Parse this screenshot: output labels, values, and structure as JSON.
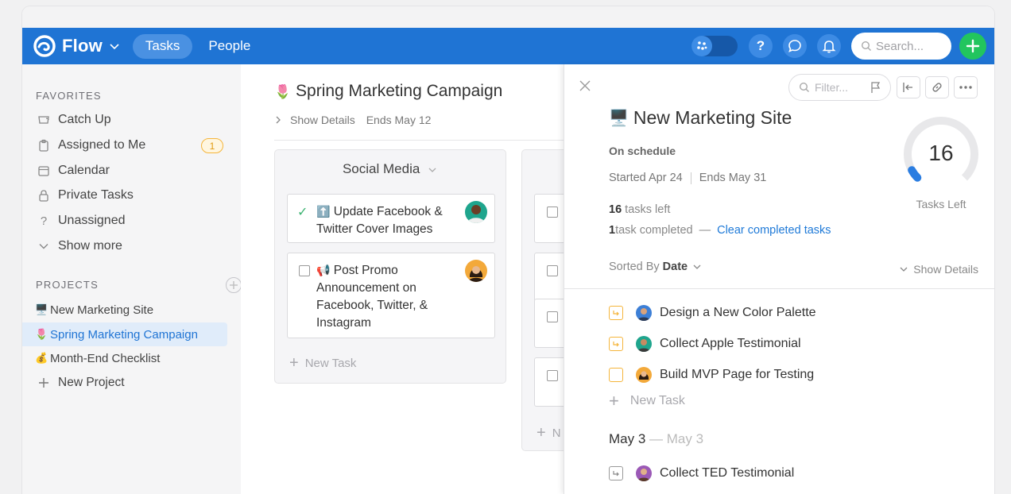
{
  "header": {
    "brand": "Flow",
    "tabs": [
      {
        "label": "Tasks",
        "active": true
      },
      {
        "label": "People",
        "active": false
      }
    ],
    "search_placeholder": "Search...",
    "help_label": "?"
  },
  "sidebar": {
    "favorites_heading": "FAVORITES",
    "favorites": [
      {
        "label": "Catch Up",
        "icon": "inbox-icon"
      },
      {
        "label": "Assigned to Me",
        "icon": "clipboard-icon",
        "badge": "1"
      },
      {
        "label": "Calendar",
        "icon": "calendar-icon"
      },
      {
        "label": "Private Tasks",
        "icon": "lock-icon"
      },
      {
        "label": "Unassigned",
        "icon": "question-icon"
      },
      {
        "label": "Show more",
        "icon": "chevron-down-icon"
      }
    ],
    "projects_heading": "PROJECTS",
    "projects": [
      {
        "label": "New Marketing Site",
        "emoji": "🖥️"
      },
      {
        "label": "Spring Marketing Campaign",
        "emoji": "🌷",
        "active": true
      },
      {
        "label": "Month-End Checklist",
        "emoji": "💰"
      }
    ],
    "new_project": "New Project"
  },
  "main": {
    "project_emoji": "🌷",
    "project_title": "Spring Marketing Campaign",
    "show_details": "Show Details",
    "ends": "Ends May 12",
    "columns": [
      {
        "title": "Social Media",
        "cards": [
          {
            "emoji": "⬆️",
            "title": "Update Facebook & Twitter Cover Images",
            "done": true
          },
          {
            "emoji": "📢",
            "title": "Post Promo Announcement on Facebook, Twitter, & Instagram",
            "done": false
          }
        ],
        "new_task": "New Task"
      }
    ],
    "column2_new_task": "N"
  },
  "panel": {
    "filter_placeholder": "Filter...",
    "emoji": "🖥️",
    "title": "New Marketing Site",
    "status": "On schedule",
    "started": "Started Apr 24",
    "ends": "Ends May 31",
    "tasks_left_count": "16",
    "tasks_left_suffix": " tasks left",
    "completed_count": "1",
    "completed_suffix": " task completed",
    "completed_dash": "—",
    "clear_link": "Clear completed tasks",
    "gauge_value": "16",
    "gauge_label": "Tasks Left",
    "gauge_fraction": 0.06,
    "sorted_by": "Sorted By",
    "sort_key": "Date",
    "show_details": "Show Details",
    "tasks": [
      {
        "title": "Design a New Color Palette",
        "box": "subtask"
      },
      {
        "title": "Collect Apple Testimonial",
        "box": "subtask"
      },
      {
        "title": "Build MVP Page for Testing",
        "box": "plain"
      }
    ],
    "new_task": "New Task",
    "date_group": "May 3",
    "date_group_range": "— May 3",
    "group_tasks": [
      {
        "title": "Collect TED Testimonial",
        "box": "subtask-gray"
      }
    ]
  },
  "colors": {
    "header_blue": "#1f74d4",
    "accent_green": "#22c55e",
    "badge_orange": "#f5b53b",
    "link_blue": "#1f7ad8"
  }
}
